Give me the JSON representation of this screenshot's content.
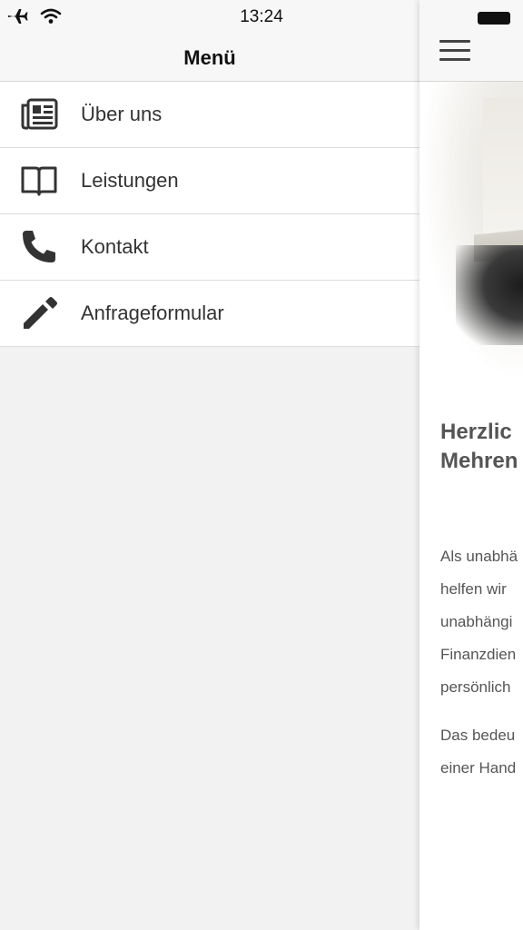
{
  "status_bar": {
    "time": "13:24",
    "icons": [
      "airplane-icon",
      "wifi-icon",
      "battery-icon"
    ]
  },
  "drawer": {
    "title": "Menü",
    "items": [
      {
        "label": "Über uns",
        "icon": "newspaper-icon"
      },
      {
        "label": "Leistungen",
        "icon": "open-book-icon"
      },
      {
        "label": "Kontakt",
        "icon": "phone-icon"
      },
      {
        "label": "Anfrageformular",
        "icon": "pencil-icon"
      }
    ]
  },
  "content": {
    "menu_icon": "hamburger-menu-icon",
    "heading": [
      "Herzlic",
      "Mehren"
    ],
    "paragraph1": [
      "Als unabhä",
      "helfen wir",
      "unabhängi",
      "Finanzdien",
      "persönlich"
    ],
    "paragraph2": [
      "Das bedeu",
      "einer Hand"
    ]
  },
  "colors": {
    "drawer_bg": "#f2f2f2",
    "menu_item_bg": "#ffffff",
    "text": "#333333",
    "header_bg": "#f7f7f7"
  }
}
